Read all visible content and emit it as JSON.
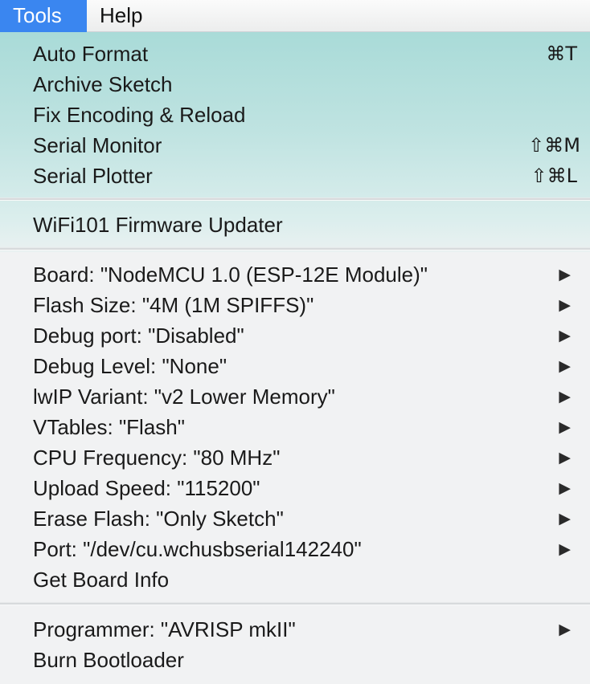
{
  "menubar": {
    "tools": "Tools",
    "help": "Help"
  },
  "menu": {
    "group1": [
      {
        "label": "Auto Format",
        "shortcut": "⌘T"
      },
      {
        "label": "Archive Sketch",
        "shortcut": ""
      },
      {
        "label": "Fix Encoding & Reload",
        "shortcut": ""
      },
      {
        "label": "Serial Monitor",
        "shortcut": "⇧⌘M"
      },
      {
        "label": "Serial Plotter",
        "shortcut": "⇧⌘L"
      }
    ],
    "group2": [
      {
        "label": "WiFi101 Firmware Updater"
      }
    ],
    "group3": [
      {
        "label": "Board: \"NodeMCU 1.0 (ESP-12E Module)\"",
        "submenu": "▶"
      },
      {
        "label": "Flash Size: \"4M (1M SPIFFS)\"",
        "submenu": "▶"
      },
      {
        "label": "Debug port: \"Disabled\"",
        "submenu": "▶"
      },
      {
        "label": "Debug Level: \"None\"",
        "submenu": "▶"
      },
      {
        "label": "lwIP Variant: \"v2 Lower Memory\"",
        "submenu": "▶"
      },
      {
        "label": "VTables: \"Flash\"",
        "submenu": "▶"
      },
      {
        "label": "CPU Frequency: \"80 MHz\"",
        "submenu": "▶"
      },
      {
        "label": "Upload Speed: \"115200\"",
        "submenu": "▶"
      },
      {
        "label": "Erase Flash: \"Only Sketch\"",
        "submenu": "▶"
      },
      {
        "label": "Port: \"/dev/cu.wchusbserial142240\"",
        "submenu": "▶"
      },
      {
        "label": "Get Board Info",
        "submenu": ""
      }
    ],
    "group4": [
      {
        "label": "Programmer: \"AVRISP mkII\"",
        "submenu": "▶"
      },
      {
        "label": "Burn Bootloader",
        "submenu": ""
      }
    ]
  },
  "colors": {
    "menubar_highlight": "#3a86f0",
    "menu_background": "#f1f2f3",
    "menu_tint": "#b5e0dd"
  }
}
